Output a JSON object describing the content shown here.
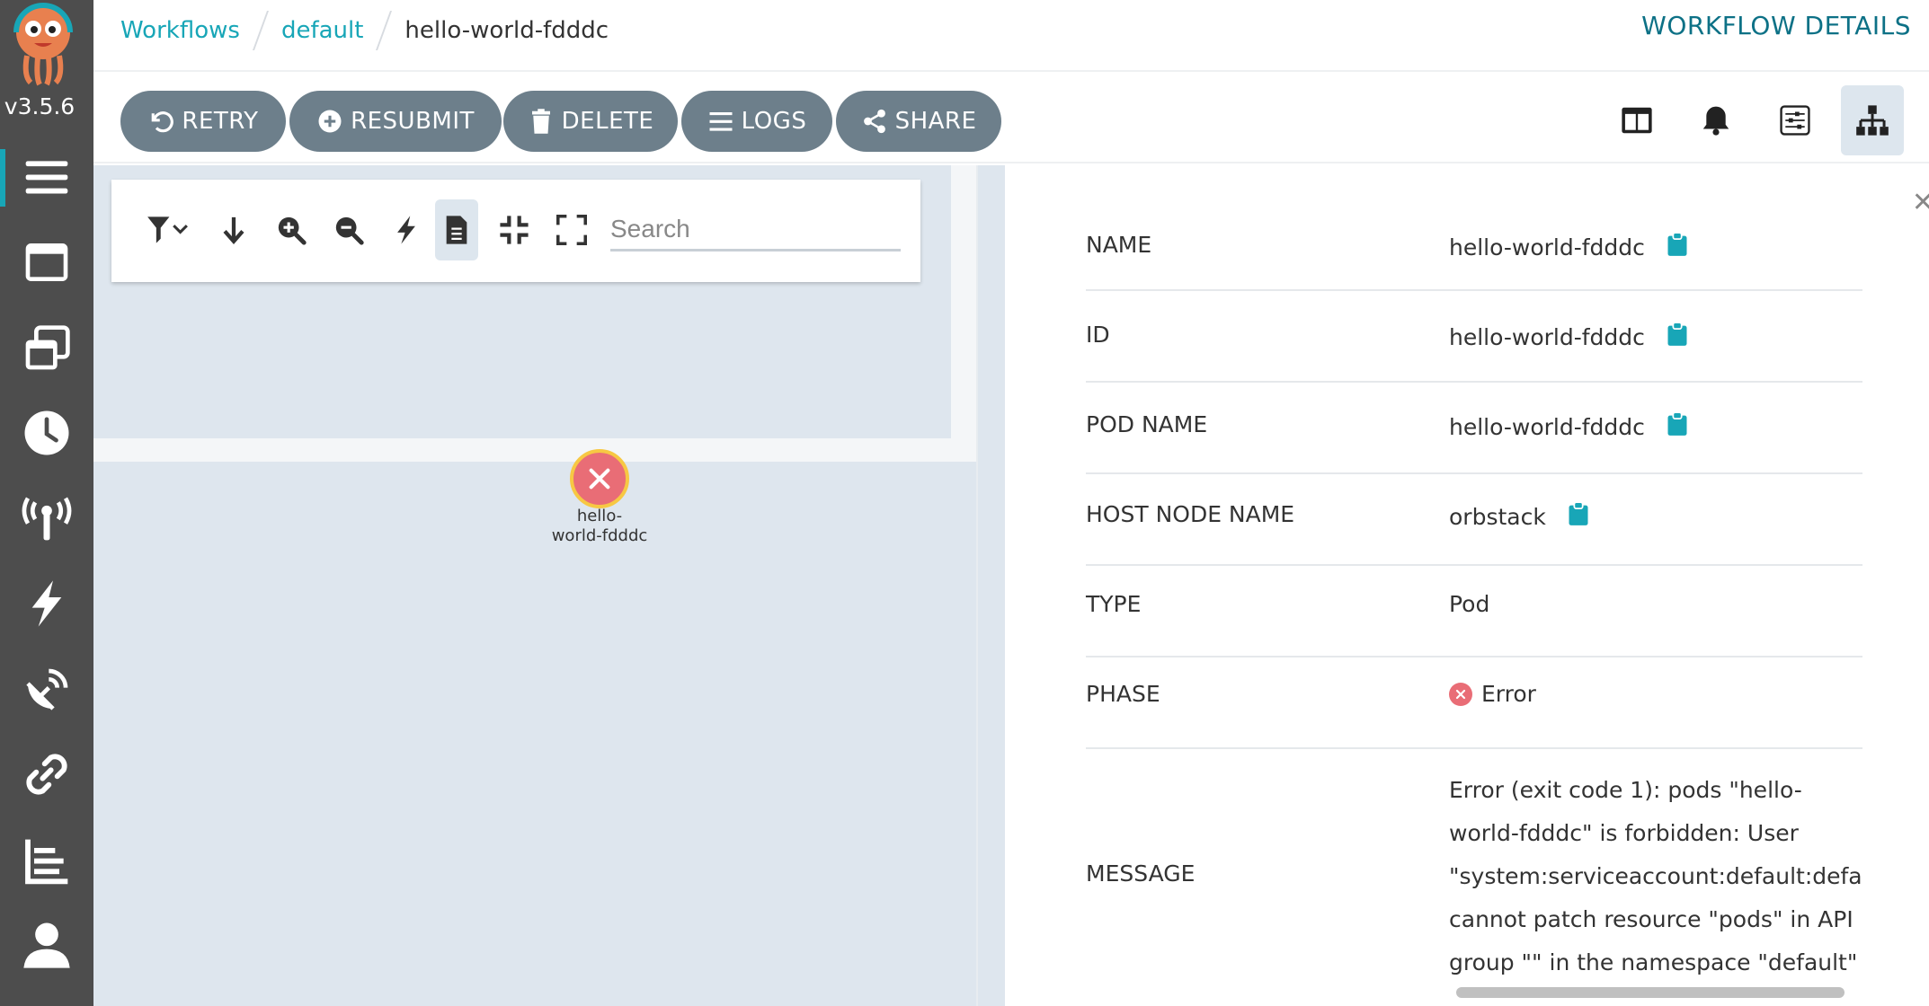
{
  "app": {
    "version": "v3.5.6",
    "title": "WORKFLOW DETAILS",
    "brand_color": "#18a6b7"
  },
  "breadcrumb": {
    "items": [
      {
        "label": "Workflows"
      },
      {
        "label": "default"
      }
    ],
    "current": "hello-world-fdddc"
  },
  "sidebar": {
    "items": [
      {
        "icon": "hamburger-icon",
        "active": true
      },
      {
        "icon": "window-icon"
      },
      {
        "icon": "stacked-windows-icon"
      },
      {
        "icon": "clock-icon"
      },
      {
        "icon": "broadcast-tower-icon"
      },
      {
        "icon": "bolt-icon"
      },
      {
        "icon": "satellite-dish-icon"
      },
      {
        "icon": "link-icon"
      },
      {
        "icon": "bar-chart-icon"
      },
      {
        "icon": "user-icon"
      }
    ]
  },
  "toolbar": {
    "retry": "RETRY",
    "resubmit": "RESUBMIT",
    "delete": "DELETE",
    "logs": "LOGS",
    "share": "SHARE"
  },
  "graph": {
    "search_placeholder": "Search",
    "node": {
      "label_line1": "hello-",
      "label_line2": "world-fdddc",
      "status": "error"
    }
  },
  "details": {
    "rows": [
      {
        "key": "NAME",
        "value": "hello-world-fdddc"
      },
      {
        "key": "ID",
        "value": "hello-world-fdddc"
      },
      {
        "key": "POD NAME",
        "value": "hello-world-fdddc"
      },
      {
        "key": "HOST NODE NAME",
        "value": "orbstack"
      },
      {
        "key": "TYPE",
        "value": "Pod"
      },
      {
        "key": "PHASE",
        "value": "Error"
      }
    ],
    "message_key": "MESSAGE",
    "message_lines": [
      "Error (exit code 1): pods \"hello-",
      "world-fdddc\" is forbidden: User",
      "\"system:serviceaccount:default:default\"",
      "cannot patch resource \"pods\" in API",
      "group \"\" in the namespace \"default\""
    ]
  }
}
